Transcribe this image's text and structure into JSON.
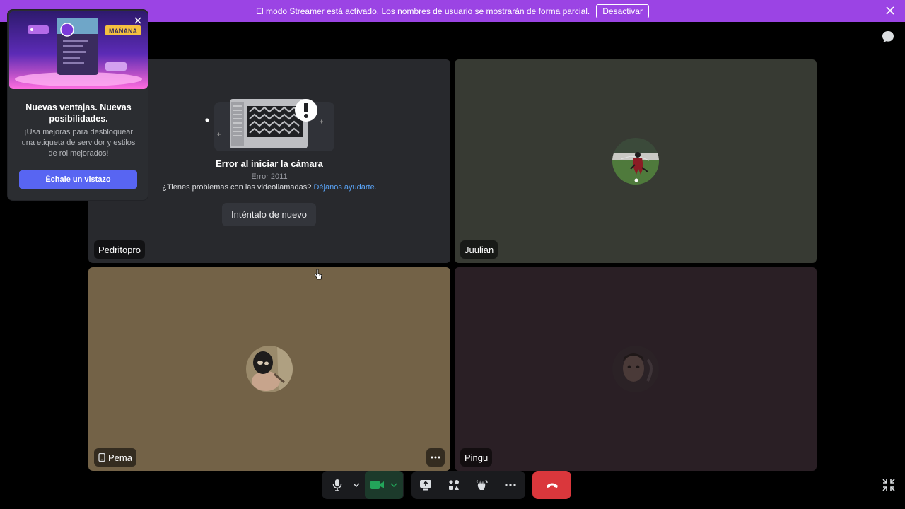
{
  "banner": {
    "message": "El modo Streamer está activado. Los nombres de usuario se mostrarán de forma parcial.",
    "button": "Desactivar"
  },
  "popup": {
    "badge": "MAÑANA",
    "title": "Nuevas ventajas. Nuevas posibilidades.",
    "description": "¡Usa mejoras para desbloquear una etiqueta de servidor y estilos de rol mejorados!",
    "cta": "Échale un vistazo"
  },
  "tiles": [
    {
      "name": "Pedritopro",
      "error_title": "Error al iniciar la cámara",
      "error_code": "Error 2011",
      "help_text": "¿Tienes problemas con las videollamadas?",
      "help_link": "Déjanos ayudarte.",
      "retry": "Inténtalo de nuevo"
    },
    {
      "name": "Juulian"
    },
    {
      "name": "Pema",
      "device": "mobile-icon"
    },
    {
      "name": "Pingu"
    }
  ],
  "colors": {
    "banner": "#9b44e4",
    "blurple": "#5865f2",
    "leave": "#da373c",
    "link": "#5aa4f7"
  }
}
